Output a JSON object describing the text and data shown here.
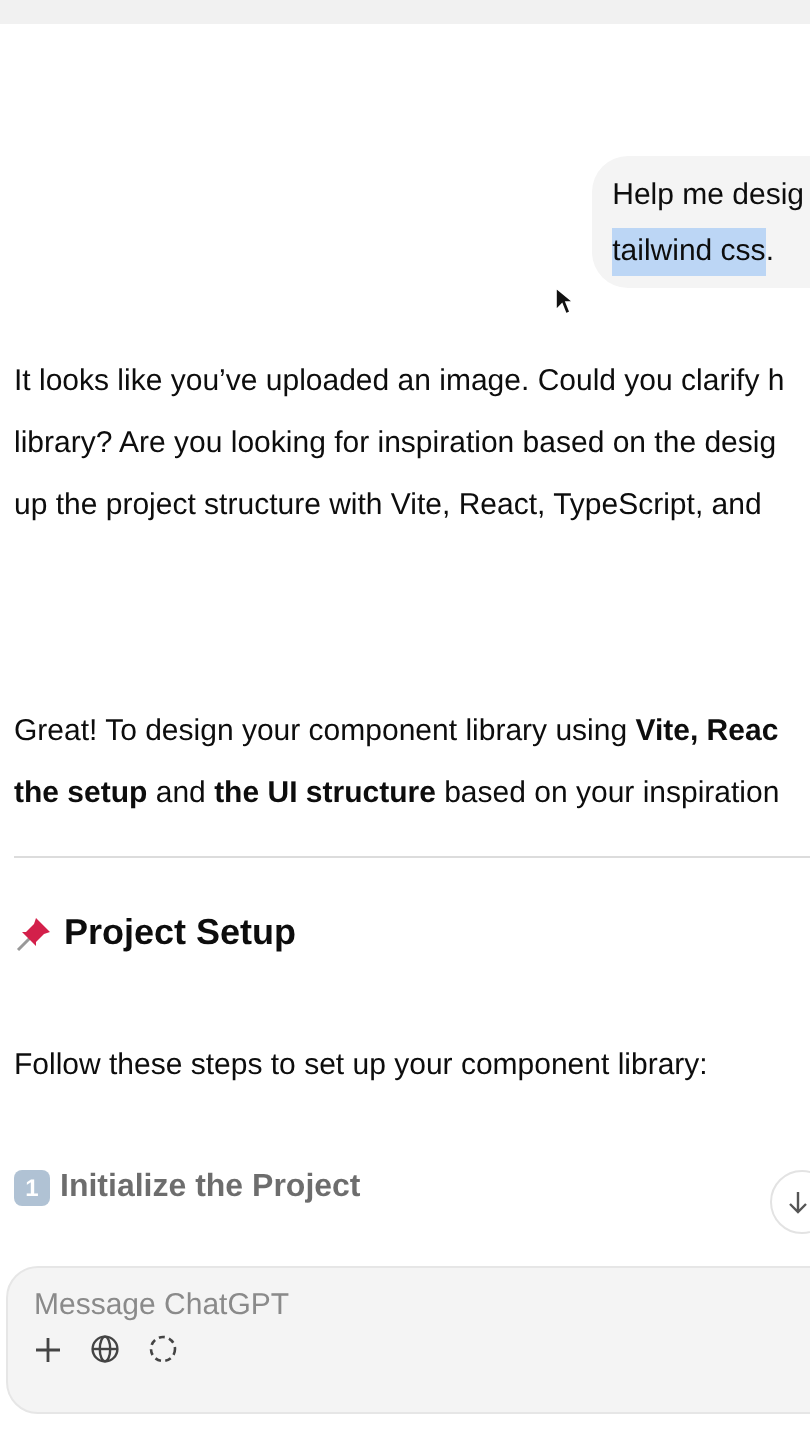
{
  "user_message": {
    "lines": [
      [
        {
          "text": "Help me desig",
          "highlighted": false
        }
      ],
      [
        {
          "text": "tailwind css",
          "highlighted": true
        },
        {
          "text": ".",
          "highlighted": false
        }
      ]
    ]
  },
  "reply_1": {
    "lines": [
      "It looks like you’ve uploaded an image. Could you clarify h",
      "library? Are you looking for inspiration based on the desig",
      "up the project structure with Vite, React, TypeScript, and"
    ]
  },
  "reply_2": {
    "lines": [
      "Great! To design your component library using **Vite, Reac**",
      "**the setup** and **the UI structure** based on your inspiration"
    ],
    "heading": "Project Setup",
    "intro": "Follow these steps to set up your component library:",
    "step": {
      "number": "1",
      "title": "Initialize the Project"
    }
  },
  "composer": {
    "placeholder": "Message ChatGPT"
  }
}
